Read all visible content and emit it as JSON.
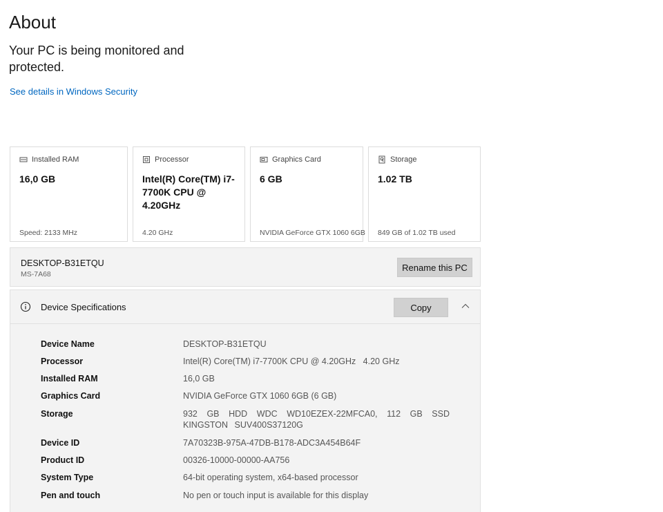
{
  "page": {
    "title": "About",
    "status": "Your PC is being monitored and protected.",
    "security_link": "See details in Windows Security"
  },
  "cards": {
    "ram": {
      "label": "Installed RAM",
      "icon": "ram-icon",
      "value": "16,0 GB",
      "sub": "Speed: 2133 MHz"
    },
    "processor": {
      "label": "Processor",
      "icon": "processor-icon",
      "value": "Intel(R) Core(TM) i7-7700K CPU @ 4.20GHz",
      "sub": "4.20 GHz"
    },
    "graphics": {
      "label": "Graphics Card",
      "icon": "graphics-card-icon",
      "value": "6 GB",
      "sub": "NVIDIA GeForce GTX 1060 6GB"
    },
    "storage": {
      "label": "Storage",
      "icon": "storage-icon",
      "value": "1.02 TB",
      "sub": "849 GB of 1.02 TB used"
    }
  },
  "pc": {
    "name": "DESKTOP-B31ETQU",
    "model": "MS-7A68",
    "rename_label": "Rename this PC"
  },
  "specs": {
    "header": "Device Specifications",
    "copy_label": "Copy",
    "rows": [
      {
        "key": "Device Name",
        "value": "DESKTOP-B31ETQU"
      },
      {
        "key": "Processor",
        "value": "Intel(R) Core(TM) i7-7700K CPU @ 4.20GHz   4.20 GHz"
      },
      {
        "key": "Installed RAM",
        "value": "16,0 GB"
      },
      {
        "key": "Graphics Card",
        "value": "NVIDIA GeForce GTX 1060 6GB (6 GB)"
      },
      {
        "key": "Storage",
        "value": "932 GB HDD WDC WD10EZEX-22MFCA0, 112 GB SSD KINGSTON SUV400S37120G"
      },
      {
        "key": "Device ID",
        "value": "7A70323B-975A-47DB-B178-ADC3A454B64F"
      },
      {
        "key": "Product ID",
        "value": "00326-10000-00000-AA756"
      },
      {
        "key": "System Type",
        "value": "64-bit operating system, x64-based processor"
      },
      {
        "key": "Pen and touch",
        "value": "No pen or touch input is available for this display"
      }
    ]
  },
  "colors": {
    "link": "#0067c0",
    "panel": "#f3f3f3",
    "button": "#d1d1d1"
  }
}
